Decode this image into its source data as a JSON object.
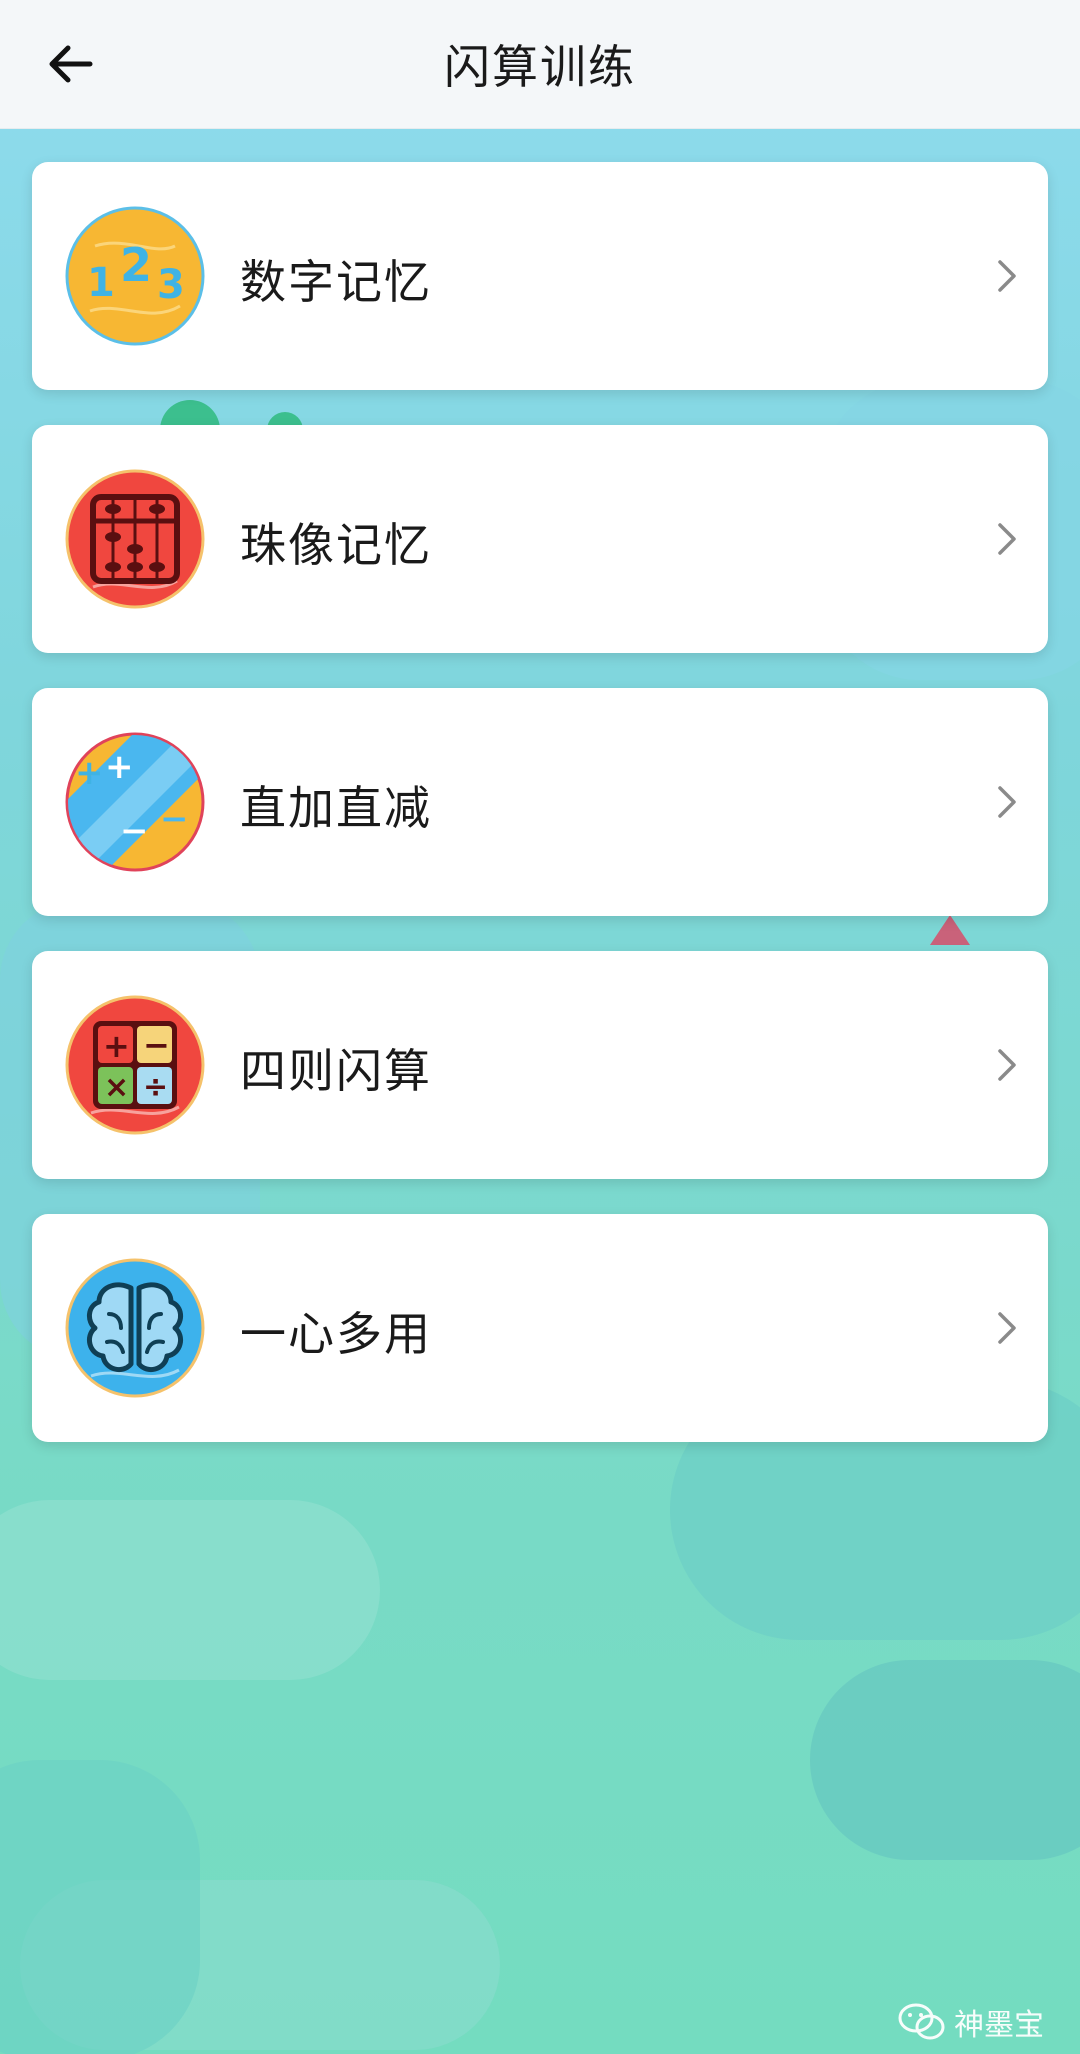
{
  "header": {
    "title": "闪算训练",
    "back_icon": "arrow-left-icon"
  },
  "items": [
    {
      "label": "数字记忆",
      "icon": "numbers-123-icon",
      "icon_bg": "#f7b733"
    },
    {
      "label": "珠像记忆",
      "icon": "abacus-icon",
      "icon_bg": "#f0473f"
    },
    {
      "label": "直加直减",
      "icon": "plus-minus-icon",
      "icon_bg": "#4ab7ef"
    },
    {
      "label": "四则闪算",
      "icon": "calculator-operations-icon",
      "icon_bg": "#f0473f"
    },
    {
      "label": "一心多用",
      "icon": "brain-icon",
      "icon_bg": "#3db2ec"
    }
  ],
  "watermark": {
    "text": "神墨宝",
    "icon": "wechat-icon"
  },
  "colors": {
    "header_bg": "#f4f7f9",
    "card_bg": "#ffffff",
    "chevron": "#8a8a8a"
  }
}
